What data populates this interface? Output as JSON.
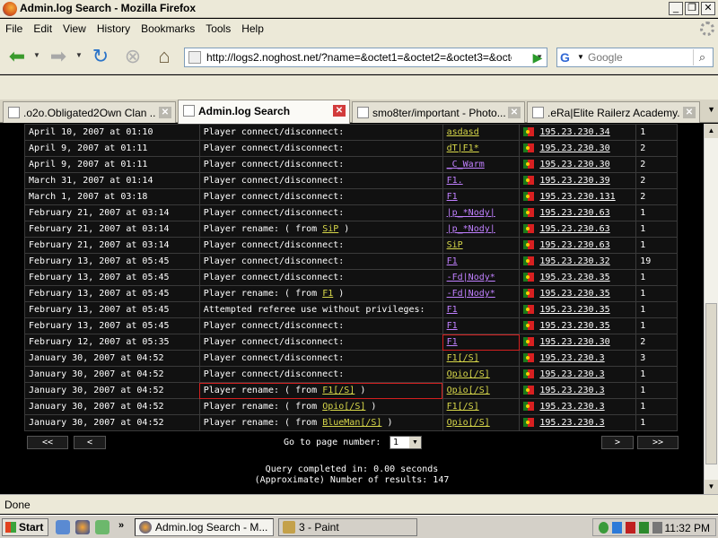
{
  "window": {
    "title": "Admin.log Search - Mozilla Firefox"
  },
  "menu": [
    "File",
    "Edit",
    "View",
    "History",
    "Bookmarks",
    "Tools",
    "Help"
  ],
  "nav": {
    "url": "http://logs2.noghost.net/?name=&octet1=&octet2=&octet3=&octet",
    "search_placeholder": "Google"
  },
  "tabs": [
    {
      "label": ".o2o.Obligated2Own Clan ..."
    },
    {
      "label": "Admin.log Search"
    },
    {
      "label": "smo8ter/important - Photo..."
    },
    {
      "label": ".eRa|Elite Railerz Academy..."
    }
  ],
  "log_rows": [
    {
      "date": "April 10, 2007 at 01:10",
      "event": "Player connect/disconnect:",
      "event_from": "",
      "event_end": "",
      "player": "asdasd",
      "ip": "195.23.230.34",
      "count": "1"
    },
    {
      "date": "April 9, 2007 at 01:11",
      "event": "Player connect/disconnect:",
      "event_from": "",
      "event_end": "",
      "player": "dT|F1*",
      "ip": "195.23.230.30",
      "count": "2"
    },
    {
      "date": "April 9, 2007 at 01:11",
      "event": "Player connect/disconnect:",
      "event_from": "",
      "event_end": "",
      "player": "_C_Warm",
      "ip": "195.23.230.30",
      "count": "2"
    },
    {
      "date": "March 31, 2007 at 01:14",
      "event": "Player connect/disconnect:",
      "event_from": "",
      "event_end": "",
      "player": "F1.",
      "ip": "195.23.230.39",
      "count": "2"
    },
    {
      "date": "March 1, 2007 at 03:18",
      "event": "Player connect/disconnect:",
      "event_from": "",
      "event_end": "",
      "player": "F1",
      "ip": "195.23.230.131",
      "count": "2"
    },
    {
      "date": "February 21, 2007 at 03:14",
      "event": "Player connect/disconnect:",
      "event_from": "",
      "event_end": "",
      "player": "|p_*Nody|",
      "ip": "195.23.230.63",
      "count": "1"
    },
    {
      "date": "February 21, 2007 at 03:14",
      "event": "Player rename: ( from",
      "event_from": "SiP",
      "event_end": " )",
      "player": "|p_*Nody|",
      "ip": "195.23.230.63",
      "count": "1"
    },
    {
      "date": "February 21, 2007 at 03:14",
      "event": "Player connect/disconnect:",
      "event_from": "",
      "event_end": "",
      "player": "SiP",
      "ip": "195.23.230.63",
      "count": "1"
    },
    {
      "date": "February 13, 2007 at 05:45",
      "event": "Player connect/disconnect:",
      "event_from": "",
      "event_end": "",
      "player": "F1",
      "ip": "195.23.230.32",
      "count": "19"
    },
    {
      "date": "February 13, 2007 at 05:45",
      "event": "Player connect/disconnect:",
      "event_from": "",
      "event_end": "",
      "player": "-Fd|Nody*",
      "ip": "195.23.230.35",
      "count": "1"
    },
    {
      "date": "February 13, 2007 at 05:45",
      "event": "Player rename: ( from",
      "event_from": "F1",
      "event_end": " )",
      "player": "-Fd|Nody*",
      "ip": "195.23.230.35",
      "count": "1"
    },
    {
      "date": "February 13, 2007 at 05:45",
      "event": "Attempted referee use without privileges:",
      "event_from": "",
      "event_end": "",
      "player": "F1",
      "ip": "195.23.230.35",
      "count": "1"
    },
    {
      "date": "February 13, 2007 at 05:45",
      "event": "Player connect/disconnect:",
      "event_from": "",
      "event_end": "",
      "player": "F1",
      "ip": "195.23.230.35",
      "count": "1"
    },
    {
      "date": "February 12, 2007 at 05:35",
      "event": "Player connect/disconnect:",
      "event_from": "",
      "event_end": "",
      "player": "F1",
      "ip": "195.23.230.30",
      "count": "2"
    },
    {
      "date": "January 30, 2007 at 04:52",
      "event": "Player connect/disconnect:",
      "event_from": "",
      "event_end": "",
      "player": "F1[/S]",
      "ip": "195.23.230.3",
      "count": "3"
    },
    {
      "date": "January 30, 2007 at 04:52",
      "event": "Player connect/disconnect:",
      "event_from": "",
      "event_end": "",
      "player": "Opio[/S]",
      "ip": "195.23.230.3",
      "count": "1"
    },
    {
      "date": "January 30, 2007 at 04:52",
      "event": "Player rename: ( from",
      "event_from": "F1[/S]",
      "event_end": " )",
      "player": "Opio[/S]",
      "ip": "195.23.230.3",
      "count": "1"
    },
    {
      "date": "January 30, 2007 at 04:52",
      "event": "Player rename: ( from",
      "event_from": "Opio[/S]",
      "event_end": " )",
      "player": "F1[/S]",
      "ip": "195.23.230.3",
      "count": "1"
    },
    {
      "date": "January 30, 2007 at 04:52",
      "event": "Player rename: ( from",
      "event_from": "BlueMan[/S]",
      "event_end": " )",
      "player": "Opio[/S]",
      "ip": "195.23.230.3",
      "count": "1"
    }
  ],
  "pager": {
    "first": "<<",
    "prev": "<",
    "next": ">",
    "last": ">>",
    "label": "Go to page number:",
    "page": "1"
  },
  "query": {
    "time": "Query completed in: 0.00 seconds",
    "results": "(Approximate) Number of results: 147"
  },
  "status": "Done",
  "taskbar": {
    "start": "Start",
    "tasks": [
      "Admin.log Search - M...",
      "3 - Paint"
    ],
    "clock": "11:32 PM"
  }
}
